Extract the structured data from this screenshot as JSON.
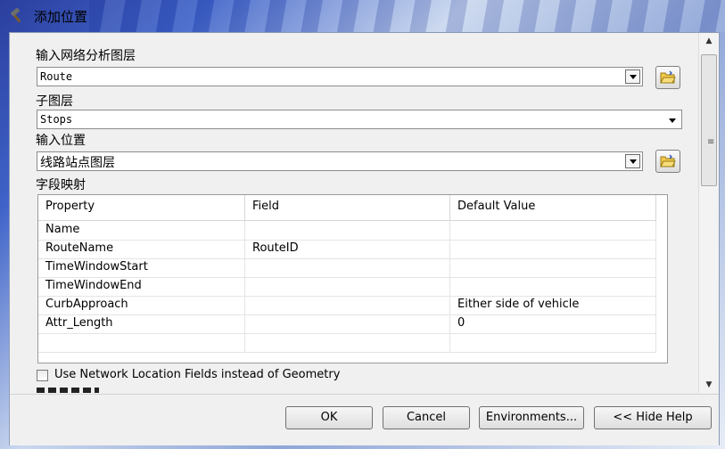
{
  "window": {
    "title": "添加位置",
    "icon": "hammer-icon"
  },
  "form": {
    "network_layer_label": "输入网络分析图层",
    "network_layer_value": "Route",
    "sublayer_label": "子图层",
    "sublayer_value": "Stops",
    "input_locations_label": "输入位置",
    "input_locations_value": "线路站点图层",
    "field_mappings_label": "字段映射"
  },
  "table": {
    "headers": [
      "Property",
      "Field",
      "Default Value"
    ],
    "rows": [
      [
        "Name",
        "",
        ""
      ],
      [
        "RouteName",
        "RouteID",
        ""
      ],
      [
        "TimeWindowStart",
        "",
        ""
      ],
      [
        "TimeWindowEnd",
        "",
        ""
      ],
      [
        "CurbApproach",
        "",
        "Either side of vehicle"
      ],
      [
        "Attr_Length",
        "",
        "0"
      ],
      [
        "",
        "",
        ""
      ]
    ]
  },
  "options": {
    "use_network_fields_label": "Use Network Location Fields instead of Geometry",
    "use_network_fields_checked": false
  },
  "buttons": {
    "ok": "OK",
    "cancel": "Cancel",
    "environments": "Environments...",
    "hide_help": "<< Hide Help"
  },
  "colors": {
    "folder_icon": "#f2c94c",
    "panel": "#f0f0f0",
    "border": "#8c8c8c"
  }
}
